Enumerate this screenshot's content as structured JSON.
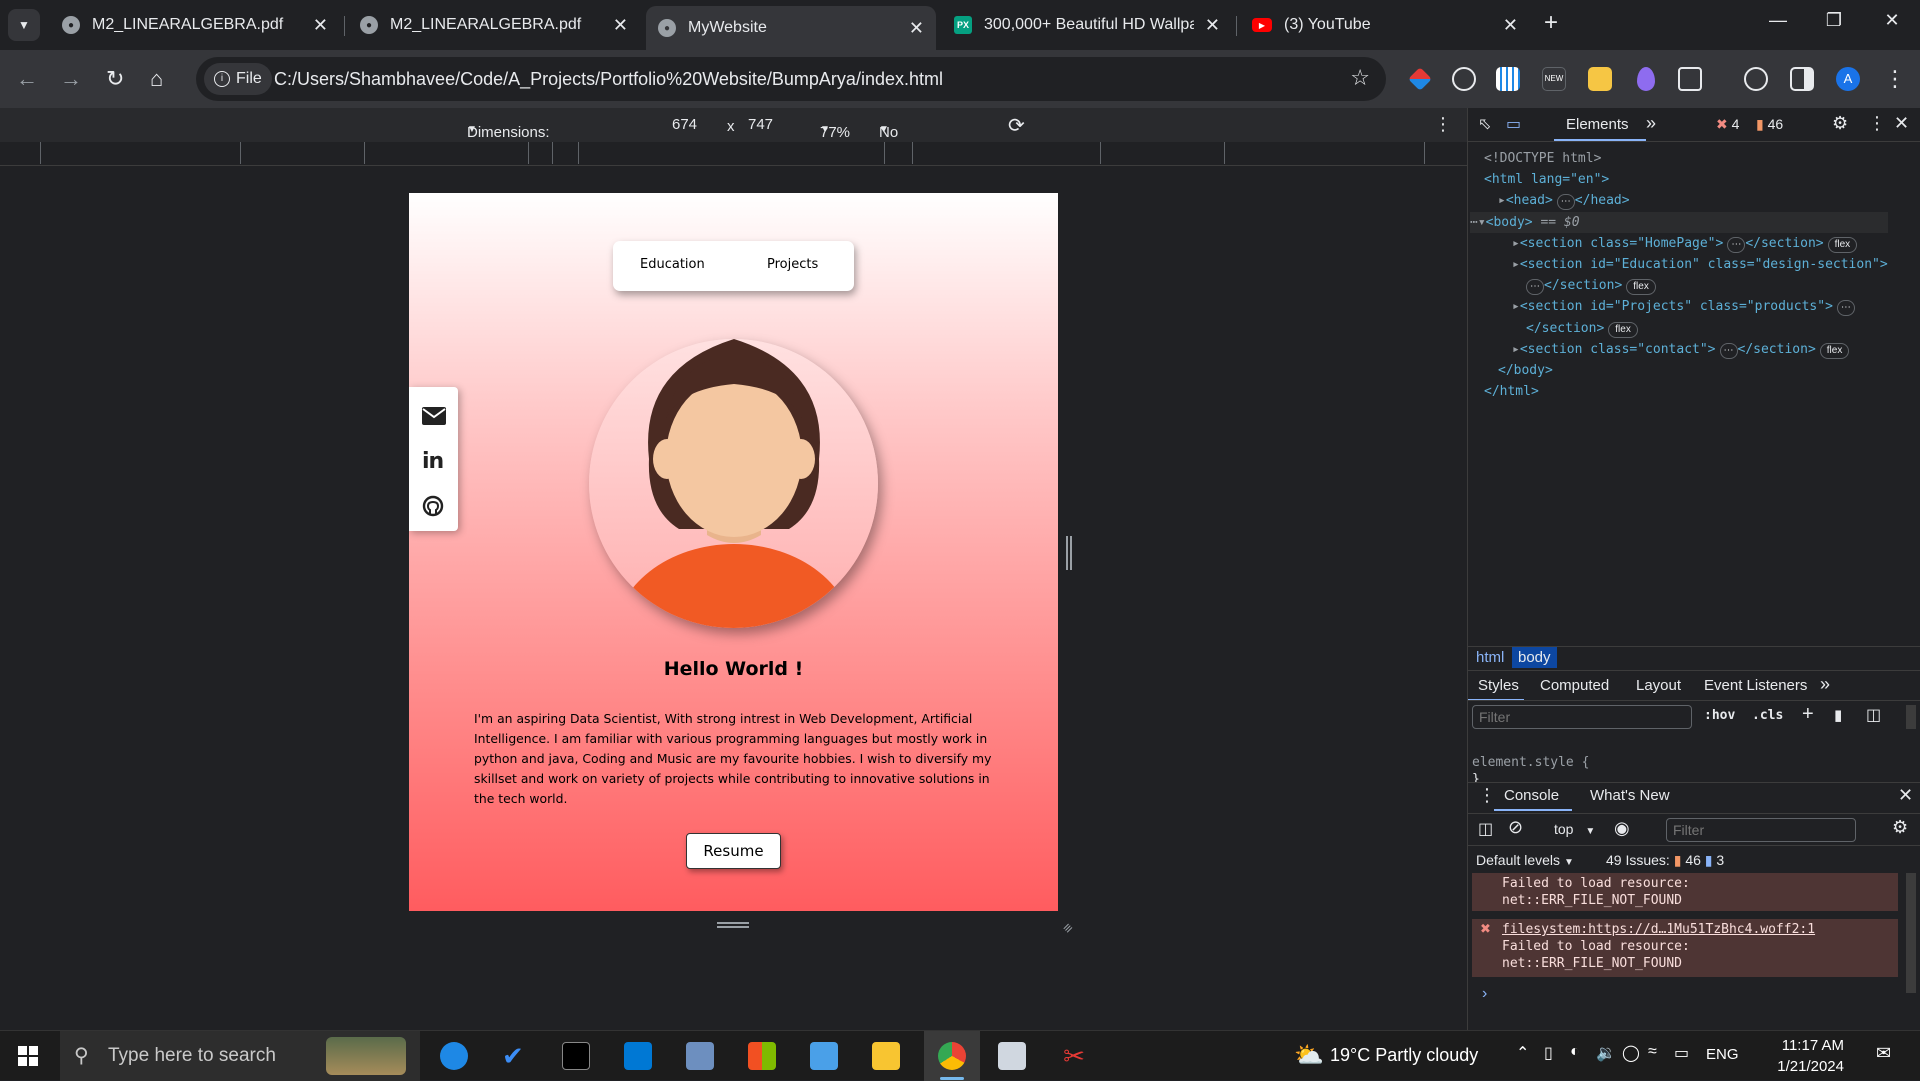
{
  "browser": {
    "tabs": [
      {
        "title": "M2_LINEARALGEBRA.pdf",
        "active": false
      },
      {
        "title": "M2_LINEARALGEBRA.pdf",
        "active": false
      },
      {
        "title": "MyWebsite",
        "active": true
      },
      {
        "title": "300,000+ Beautiful HD Wallpap",
        "active": false
      },
      {
        "title": "(3) YouTube",
        "active": false
      }
    ],
    "new_tab_glyph": "+",
    "address": {
      "scheme_chip": "File",
      "url": "C:/Users/Shambhavee/Code/A_Projects/Portfolio%20Website/BumpArya/index.html"
    },
    "profile_initial": "A"
  },
  "device_toolbar": {
    "dimensions_label": "Dimensions: Responsive",
    "width": "674",
    "times": "x",
    "height": "747",
    "zoom": "77%",
    "throttling": "No throttling"
  },
  "site": {
    "nav": {
      "education": "Education",
      "projects": "Projects"
    },
    "social_icons": [
      "envelope-icon",
      "linkedin-icon",
      "github-icon"
    ],
    "social_linkedin_glyph": "in",
    "heading": "Hello World !",
    "about": "I'm an aspiring Data Scientist, With strong intrest in Web Development, Artificial Intelligence. I am familiar with various programming languages but mostly work in python and java, Coding and Music are my favourite hobbies. I wish to diversify my skillset and work on variety of projects while contributing to innovative solutions in the tech world.",
    "resume_button": "Resume"
  },
  "devtools": {
    "panel_tab": "Elements",
    "more_tabs": "»",
    "errors_count": "4",
    "warnings_count": "46",
    "dom": {
      "doctype": "<!DOCTYPE html>",
      "html_open": "<html lang=\"en\">",
      "head": "<head>",
      "head_close": "</head>",
      "body_open": "<body>",
      "body_eq": "== $0",
      "sec1": "<section class=\"HomePage\">",
      "sec2": "<section id=\"Education\" class=\"design-section\">",
      "sec3": "<section id=\"Projects\" class=\"products\">",
      "sec4": "<section class=\"contact\">",
      "section_close": "</section>",
      "body_close": "</body>",
      "html_close": "</html>",
      "badge": "flex"
    },
    "breadcrumb": [
      "html",
      "body"
    ],
    "styles_tabs": [
      "Styles",
      "Computed",
      "Layout",
      "Event Listeners"
    ],
    "styles_filter_placeholder": "Filter",
    "hov": ":hov",
    "cls": ".cls",
    "element_style": "element.style {",
    "element_style_close": "}",
    "drawer_tabs": [
      "Console",
      "What's New"
    ],
    "console": {
      "context": "top",
      "filter_placeholder": "Filter",
      "levels": "Default levels",
      "issues_label": "49 Issues:",
      "issues_warnings": "46",
      "issues_info": "3",
      "msg1_line1": "Failed to load resource:",
      "msg1_line2": "net::ERR_FILE_NOT_FOUND",
      "msg2_link": "filesystem:https://d…1Mu51TzBhc4.woff2:1",
      "msg2_line1": "Failed to load resource:",
      "msg2_line2": "net::ERR_FILE_NOT_FOUND",
      "prompt": "›"
    }
  },
  "taskbar": {
    "search_placeholder": "Type here to search",
    "weather": "19°C  Partly cloudy",
    "language": "ENG",
    "time": "11:17 AM",
    "date": "1/21/2024"
  }
}
